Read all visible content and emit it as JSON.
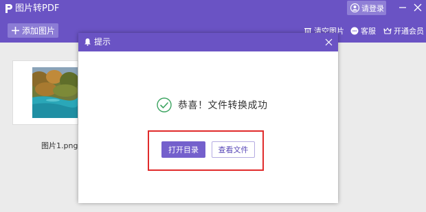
{
  "app": {
    "title": "图片转PDF",
    "login_label": "请登录"
  },
  "toolbar": {
    "add_label": "添加图片",
    "clear_label": "清空图片",
    "service_label": "客服",
    "vip_label": "开通会员"
  },
  "files": [
    {
      "name": "图片1.png"
    }
  ],
  "dialog": {
    "title": "提示",
    "message": "恭喜！文件转换成功",
    "open_dir_label": "打开目录",
    "view_file_label": "查看文件"
  },
  "colors": {
    "brand": "#6a53c4",
    "primary_button": "#7460cc",
    "success_icon": "#3aa35f",
    "highlight": "#e02a2a"
  },
  "icons": {
    "logo": "app-logo-p",
    "login": "user-circle-icon",
    "clear": "trash-icon",
    "service": "chat-bubble-icon",
    "vip": "crown-icon",
    "dialog": "bell-icon",
    "success": "check-circle-icon"
  }
}
